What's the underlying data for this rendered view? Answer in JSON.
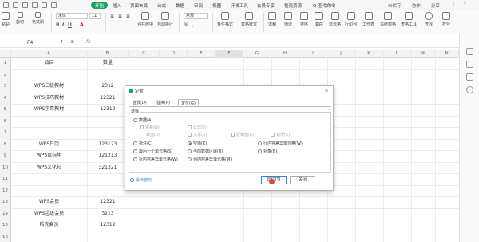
{
  "menu_tabs": [
    "开始",
    "插入",
    "页面布局",
    "公式",
    "数据",
    "审阅",
    "视图",
    "开发工具",
    "会员专享",
    "稻壳资源",
    "Q 查找命令"
  ],
  "active_menu_tab": "开始",
  "top_right_tools": [
    "未保存",
    "协作",
    "分享"
  ],
  "ribbon": {
    "paste_label": "粘贴",
    "cut_label": "剪切",
    "copy_label": "复制",
    "format_painter_label": "格式刷",
    "font_name": "宋体",
    "font_size": "11",
    "merge_center_label": "合并居中",
    "auto_wrap_label": "自动换行",
    "number_format": "常规",
    "cond_format_label": "条件格式",
    "cell_style_label": "表格样式",
    "sum_label": "求和",
    "filter_label": "筛选",
    "sort_label": "排序",
    "fill_label": "填充",
    "cell_label": "单元格",
    "rowcol_label": "行和列",
    "sheet_label": "工作表",
    "freeze_label": "冻结窗格",
    "table_tools_label": "表格工具",
    "find_label": "查找",
    "symbol_label": "符号"
  },
  "formula_bar": {
    "name_box": "F4",
    "fx": "fx"
  },
  "columns": [
    "A",
    "B",
    "C",
    "D",
    "E",
    "F",
    "G",
    "H",
    "I",
    "J",
    "K",
    "L",
    "M",
    "N"
  ],
  "row_numbers": [
    "1",
    "2",
    "3",
    "4",
    "5",
    "6",
    "7",
    "8",
    "9",
    "10",
    "11",
    "12",
    "13",
    "14",
    "15",
    "16"
  ],
  "cells_a": {
    "1": "品目",
    "3": "WPS二级教材",
    "4": "WPS技巧教材",
    "5": "WPS字幕教材",
    "8": "WPS日历",
    "9": "WPS鼠标垫",
    "10": "WPS文化衫",
    "13": "WPS会员",
    "14": "WPS超级会员",
    "15": "稻壳会员"
  },
  "cells_b": {
    "1": "数量",
    "3": "2312",
    "4": "12321",
    "5": "12312",
    "8": "123123",
    "9": "121213",
    "10": "321321",
    "13": "12321",
    "14": "3213",
    "15": "12312"
  },
  "dialog": {
    "title": "定位",
    "tabs": [
      "查找(D)",
      "替换(P)",
      "定位(G)"
    ],
    "active_tab": "定位(G)",
    "group_label": "选择",
    "options": {
      "data": "数据(A)",
      "constant": "常量(N)",
      "formula": "公式(F)",
      "sub_labels": "数值(U)",
      "sub_text": "文本(X)",
      "sub_logic": "逻辑值(L)",
      "sub_error": "错误(E)",
      "blank": "批注(C)",
      "empty_value": "空值(K)",
      "row_diff": "行内容差异单元格(W)",
      "visible": "可见单元格(Y)",
      "last_cell": "最后一个单元格(S)",
      "current_array": "当前数据区域(R)",
      "obj": "对象(B)",
      "col_diff": "列内容差异单元格(M)",
      "diff_row": "行内容差异单元格(W)",
      "diff_col": "列内容差异单元格(M)"
    },
    "selected_option": "空值(K)",
    "tips_label": "操作技巧",
    "ok_label": "定位(T)",
    "close_label": "关闭"
  }
}
